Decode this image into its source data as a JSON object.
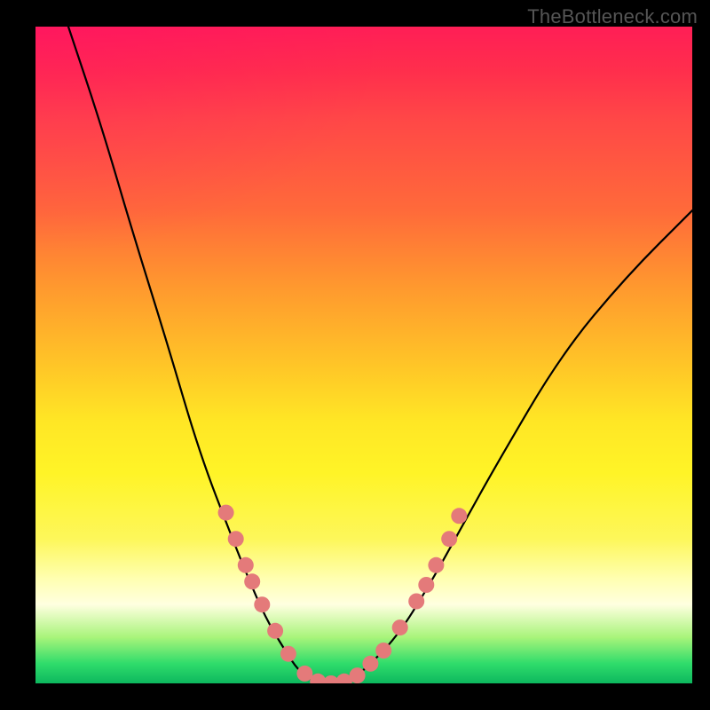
{
  "watermark": "TheBottleneck.com",
  "chart_data": {
    "type": "line",
    "title": "",
    "xlabel": "",
    "ylabel": "",
    "xlim": [
      0,
      100
    ],
    "ylim": [
      0,
      100
    ],
    "series": [
      {
        "name": "bottleneck-curve",
        "x": [
          5,
          10,
          15,
          20,
          25,
          30,
          32,
          35,
          38,
          40,
          42,
          44,
          46,
          48,
          50,
          55,
          60,
          65,
          70,
          80,
          90,
          100
        ],
        "y": [
          100,
          85,
          68,
          52,
          35,
          22,
          17,
          10,
          5,
          2,
          0.5,
          0,
          0,
          0.5,
          2,
          7,
          15,
          24,
          33,
          50,
          62,
          72
        ]
      }
    ],
    "markers": {
      "name": "highlighted-points",
      "color": "#e47a7a",
      "radius_px": 9,
      "points": [
        {
          "x": 29,
          "y": 26
        },
        {
          "x": 30.5,
          "y": 22
        },
        {
          "x": 32,
          "y": 18
        },
        {
          "x": 33,
          "y": 15.5
        },
        {
          "x": 34.5,
          "y": 12
        },
        {
          "x": 36.5,
          "y": 8
        },
        {
          "x": 38.5,
          "y": 4.5
        },
        {
          "x": 41,
          "y": 1.5
        },
        {
          "x": 43,
          "y": 0.3
        },
        {
          "x": 45,
          "y": 0
        },
        {
          "x": 47,
          "y": 0.3
        },
        {
          "x": 49,
          "y": 1.2
        },
        {
          "x": 51,
          "y": 3
        },
        {
          "x": 53,
          "y": 5
        },
        {
          "x": 55.5,
          "y": 8.5
        },
        {
          "x": 58,
          "y": 12.5
        },
        {
          "x": 59.5,
          "y": 15
        },
        {
          "x": 61,
          "y": 18
        },
        {
          "x": 63,
          "y": 22
        },
        {
          "x": 64.5,
          "y": 25.5
        }
      ]
    },
    "background_gradient": {
      "orientation": "vertical",
      "stops": [
        {
          "pos": 0,
          "color": "#ff1e56"
        },
        {
          "pos": 0.5,
          "color": "#ffe625"
        },
        {
          "pos": 0.88,
          "color": "#ffffe0"
        },
        {
          "pos": 1,
          "color": "#0db85e"
        }
      ]
    }
  }
}
